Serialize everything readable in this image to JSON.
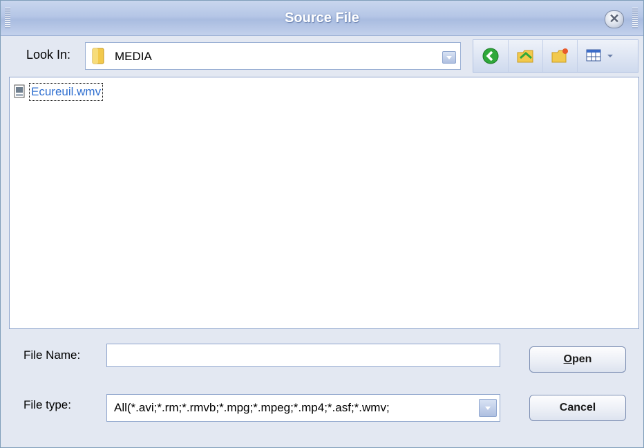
{
  "window": {
    "title": "Source File",
    "close_glyph": "✕"
  },
  "toolbar": {
    "lookin_label": "Look In:",
    "current_folder": "MEDIA",
    "buttons": [
      {
        "icon": "back-icon"
      },
      {
        "icon": "up-folder-icon"
      },
      {
        "icon": "new-folder-icon"
      },
      {
        "icon": "view-menu-icon"
      }
    ]
  },
  "files": [
    {
      "name": "Ecureuil.wmv",
      "icon": "video-file-icon",
      "selected": true
    }
  ],
  "bottom": {
    "filename_label": "File Name:",
    "filename_value": "",
    "filetype_label": "File type:",
    "filetype_value": "All(*.avi;*.rm;*.rmvb;*.mpg;*.mpeg;*.mp4;*.asf;*.wmv;",
    "open_label_underlined": "O",
    "open_label_rest": "pen",
    "cancel_label": "Cancel"
  },
  "colors": {
    "title_text": "#ffffff",
    "file_link": "#2f6fd0",
    "accent_border": "#8ea4cc"
  }
}
